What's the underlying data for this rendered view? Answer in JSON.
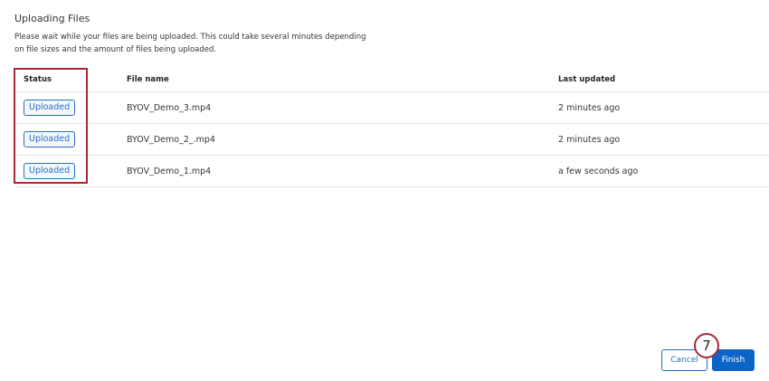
{
  "dialog": {
    "title": "Uploading Files",
    "description": "Please wait while your files are being uploaded. This could take several minutes depending on file sizes and the amount of files being uploaded."
  },
  "table": {
    "headers": {
      "status": "Status",
      "file_name": "File name",
      "last_updated": "Last updated"
    },
    "rows": [
      {
        "status": "Uploaded",
        "file_name": "BYOV_Demo_3.mp4",
        "last_updated": "2 minutes ago"
      },
      {
        "status": "Uploaded",
        "file_name": "BYOV_Demo_2_.mp4",
        "last_updated": "2 minutes ago"
      },
      {
        "status": "Uploaded",
        "file_name": "BYOV_Demo_1.mp4",
        "last_updated": "a few seconds ago"
      }
    ]
  },
  "footer": {
    "cancel_label": "Cancel",
    "finish_label": "Finish"
  },
  "annotation": {
    "step_number": "7"
  },
  "colors": {
    "accent": "#0b64c8",
    "badge": "#2d6fc0",
    "highlight": "#a8283a"
  }
}
